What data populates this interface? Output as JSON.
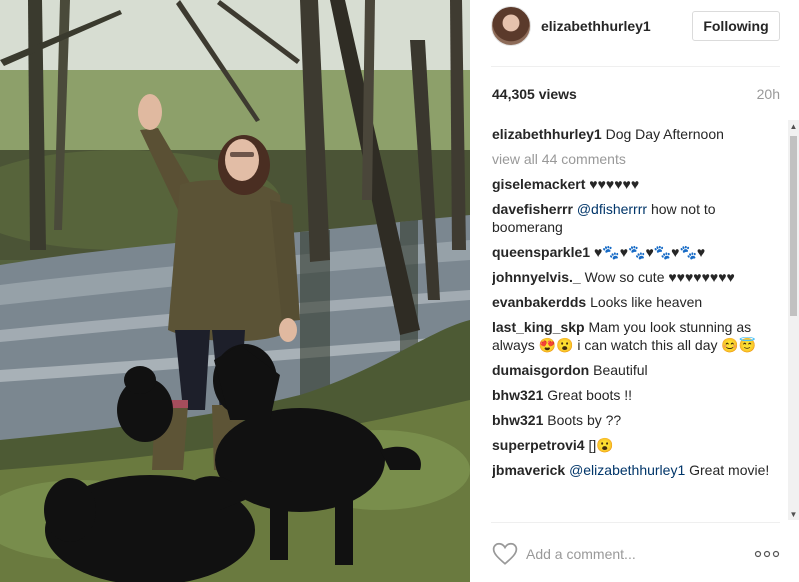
{
  "post": {
    "username": "elizabethhurley1",
    "follow_label": "Following",
    "views": "44,305 views",
    "time_ago": "20h",
    "caption": {
      "user": "elizabethhurley1",
      "text": "Dog Day Afternoon"
    },
    "view_all_comments": "view all 44 comments",
    "comments": [
      {
        "user": "giselemackert",
        "mention": "",
        "text": "♥♥♥♥♥♥"
      },
      {
        "user": "davefisherrr",
        "mention": "@dfisherrrr",
        "text": "how not to boomerang"
      },
      {
        "user": "queensparkle1",
        "mention": "",
        "text": "♥🐾♥🐾♥🐾♥🐾♥"
      },
      {
        "user": "johnnyelvis._",
        "mention": "",
        "text": "Wow so cute ♥♥♥♥♥♥♥♥"
      },
      {
        "user": "evanbakerdds",
        "mention": "",
        "text": "Looks like heaven"
      },
      {
        "user": "last_king_skp",
        "mention": "",
        "text": "Mam you look stunning as always 😍😮 i can watch this all day 😊😇"
      },
      {
        "user": "dumaisgordon",
        "mention": "",
        "text": "Beautiful"
      },
      {
        "user": "bhw321",
        "mention": "",
        "text": "Great boots !!"
      },
      {
        "user": "bhw321",
        "mention": "",
        "text": "Boots by ??"
      },
      {
        "user": "superpetrovi4",
        "mention": "",
        "text": "[]😮"
      },
      {
        "user": "jbmaverick",
        "mention": "@elizabethhurley1",
        "text": "Great movie!"
      }
    ],
    "add_comment_placeholder": "Add a comment..."
  },
  "icons": {
    "like": "heart-outline-icon",
    "more": "more-options-icon",
    "scroll_up": "▲",
    "scroll_down": "▼"
  },
  "colors": {
    "mention": "#003569",
    "muted": "#999999",
    "text": "#262626",
    "border": "#dbdbdb"
  }
}
